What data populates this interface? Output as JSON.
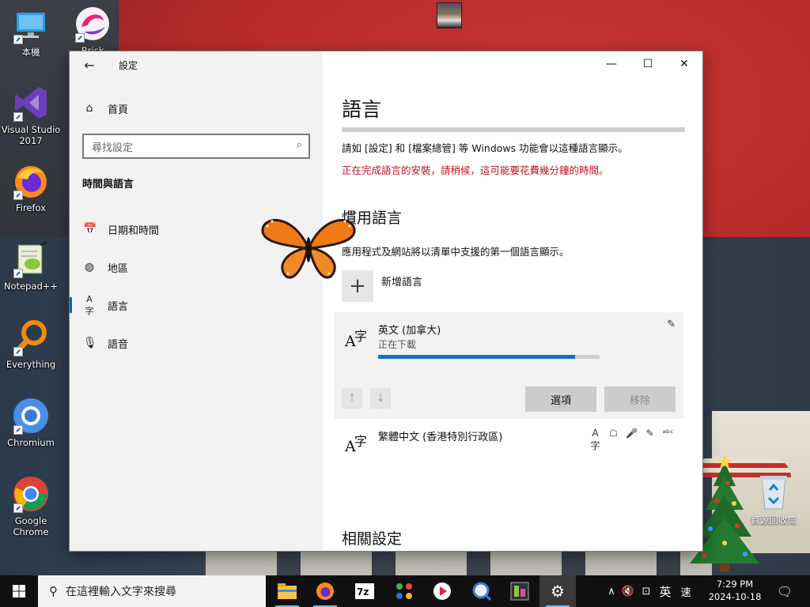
{
  "desktop": {
    "icons": [
      {
        "label": "本機",
        "icon": "computer-icon"
      },
      {
        "label": "Brisk",
        "icon": "brisk-icon"
      },
      {
        "label": "Visual Studio 2017",
        "icon": "visual-studio-icon"
      },
      {
        "label": "Firefox",
        "icon": "firefox-icon"
      },
      {
        "label": "Notepad++",
        "icon": "notepad-plus-plus-icon"
      },
      {
        "label": "Everything",
        "icon": "everything-icon"
      },
      {
        "label": "Chromium",
        "icon": "chromium-icon"
      },
      {
        "label": "Google Chrome",
        "icon": "google-chrome-icon"
      }
    ],
    "recycle_bin": "資源回收筒"
  },
  "window": {
    "title": "設定",
    "controls": {
      "minimize": "—",
      "maximize": "☐",
      "close": "✕"
    },
    "sidebar": {
      "home": "首頁",
      "search_placeholder": "尋找設定",
      "section": "時間與語言",
      "items": [
        {
          "label": "日期和時間",
          "icon": "calendar-clock-icon",
          "active": false
        },
        {
          "label": "地區",
          "icon": "globe-icon",
          "active": false
        },
        {
          "label": "語言",
          "icon": "language-icon",
          "active": true
        },
        {
          "label": "語音",
          "icon": "microphone-icon",
          "active": false
        }
      ]
    },
    "content": {
      "title": "語言",
      "display_desc": "請如 [設定] 和 [檔案總管] 等 Windows 功能會以這種語言顯示。",
      "install_warning": "正在完成語言的安裝，請稍候，這可能要花費幾分鐘的時間。",
      "preferred_heading": "慣用語言",
      "preferred_desc": "應用程式及網站將以清單中支援的第一個語言顯示。",
      "add_language": "新增語言",
      "languages": [
        {
          "name": "英文 (加拿大)",
          "status": "正在下載",
          "progress": 0.89
        },
        {
          "name": "繁體中文 (香港特別行政區)"
        }
      ],
      "options_button": "選項",
      "remove_button": "移除",
      "related_heading": "相關設定"
    }
  },
  "taskbar": {
    "search_placeholder": "在這裡輸入文字來搜尋",
    "ime_lang": "英",
    "ime_mode": "速",
    "time": "7:29 PM",
    "date": "2024-10-18"
  }
}
